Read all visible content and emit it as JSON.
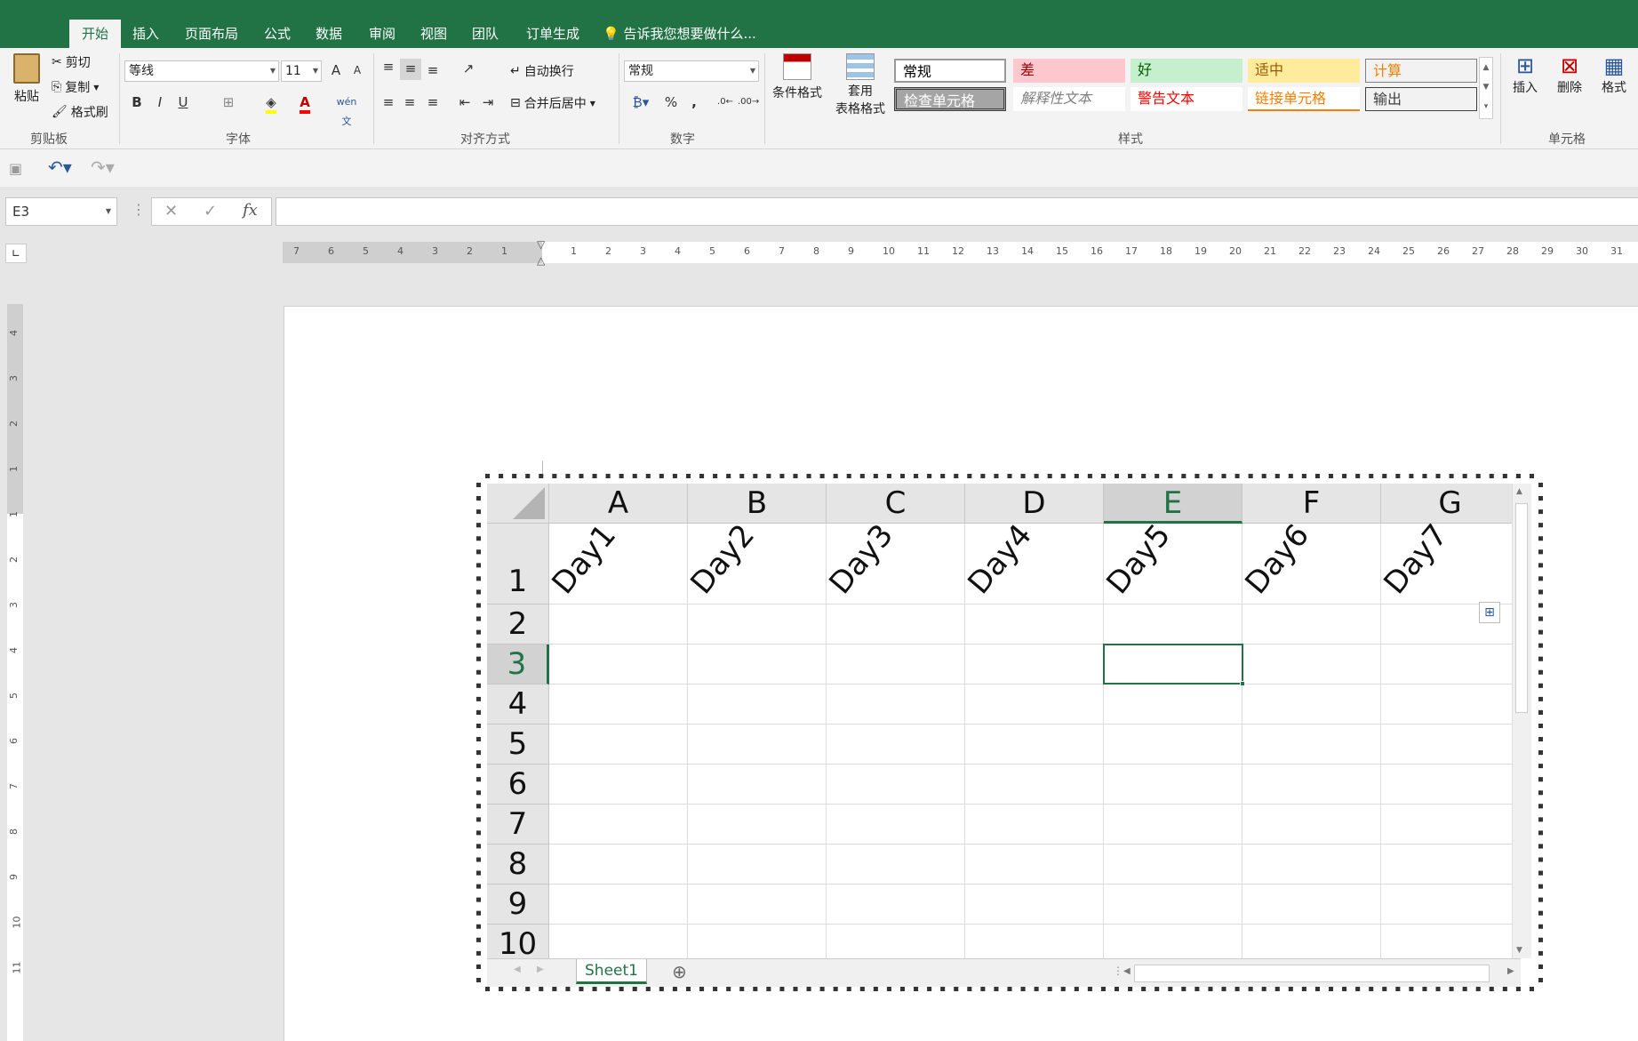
{
  "tabs": [
    "开始",
    "插入",
    "页面布局",
    "公式",
    "数据",
    "审阅",
    "视图",
    "团队",
    "订单生成"
  ],
  "tell_me": "告诉我您想要做什么...",
  "clipboard": {
    "paste": "粘贴",
    "cut": "剪切",
    "copy": "复制",
    "format_painter": "格式刷",
    "group": "剪贴板"
  },
  "font": {
    "name": "等线",
    "size": "11",
    "group": "字体",
    "bold": "B",
    "italic": "I",
    "underline": "U",
    "grow": "A",
    "shrink": "A",
    "phonetic": "wén 文"
  },
  "alignment": {
    "wrap": "自动换行",
    "merge": "合并后居中",
    "group": "对齐方式"
  },
  "number": {
    "format": "常规",
    "group": "数字",
    "percent": "%",
    "comma": ","
  },
  "styles": {
    "conditional": "条件格式",
    "table_format_1": "套用",
    "table_format_2": "表格格式",
    "group": "样式",
    "cells": [
      {
        "label": "常规",
        "bg": "#ffffff",
        "fg": "#000000"
      },
      {
        "label": "差",
        "bg": "#ffc7ce",
        "fg": "#9c0006"
      },
      {
        "label": "好",
        "bg": "#c6efce",
        "fg": "#006100"
      },
      {
        "label": "适中",
        "bg": "#ffeb9c",
        "fg": "#9c5700"
      },
      {
        "label": "计算",
        "bg": "#f2f2f2",
        "fg": "#fa7d00"
      },
      {
        "label": "检查单元格",
        "bg": "#a5a5a5",
        "fg": "#ffffff"
      },
      {
        "label": "解释性文本",
        "bg": "#ffffff",
        "fg": "#7f7f7f"
      },
      {
        "label": "警告文本",
        "bg": "#ffffff",
        "fg": "#ff0000"
      },
      {
        "label": "链接单元格",
        "bg": "#ffffff",
        "fg": "#fa7d00"
      },
      {
        "label": "输出",
        "bg": "#f2f2f2",
        "fg": "#3f3f3f"
      }
    ]
  },
  "cells_group": {
    "insert": "插入",
    "delete": "删除",
    "format": "格式",
    "group": "单元格"
  },
  "formula": {
    "name_box": "E3",
    "fx": "fx",
    "cancel": "✕",
    "enter": "✓",
    "value": ""
  },
  "hruler_left": [
    "7",
    "6",
    "5",
    "4",
    "3",
    "2",
    "1"
  ],
  "hruler_right": [
    "1",
    "2",
    "3",
    "4",
    "5",
    "6",
    "7",
    "8",
    "9",
    "10",
    "11",
    "12",
    "13",
    "14",
    "15",
    "16",
    "17",
    "18",
    "19",
    "20",
    "21",
    "22",
    "23",
    "24",
    "25",
    "26",
    "27",
    "28",
    "29",
    "30",
    "31"
  ],
  "vruler": [
    "4",
    "3",
    "2",
    "1",
    "1",
    "2",
    "3",
    "4",
    "5",
    "6",
    "7",
    "8",
    "9",
    "10",
    "11"
  ],
  "sheet": {
    "columns": [
      "A",
      "B",
      "C",
      "D",
      "E",
      "F",
      "G"
    ],
    "rows": [
      "1",
      "2",
      "3",
      "4",
      "5",
      "6",
      "7",
      "8",
      "9",
      "10"
    ],
    "selected_column": "E",
    "selected_row": "3",
    "row1_values": [
      "Day1",
      "Day2",
      "Day3",
      "Day4",
      "Day5",
      "Day6",
      "Day7"
    ],
    "tab": "Sheet1",
    "accent": "#217346"
  }
}
